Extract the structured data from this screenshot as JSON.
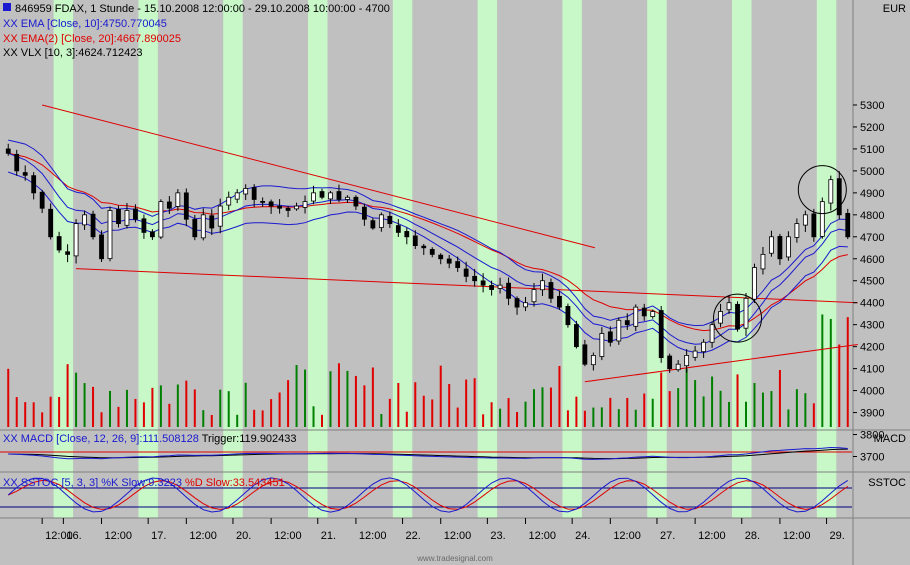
{
  "header": {
    "symbol_icon": "square-bullet-icon",
    "title": "846959  FDAX, 1 Stunde - 15.10.2008 12:00:00 - 29.10.2008 10:00:00 - 4700",
    "currency": "EUR"
  },
  "legend": [
    {
      "text": "XX EMA [Close, 10]:4750.770045",
      "color": "#1a1ad0"
    },
    {
      "text": "XX EMA(2) [Close, 20]:4667.890025",
      "color": "#e00000"
    },
    {
      "text": "XX VLX [10, 3]:4624.712423",
      "color": "#000000"
    }
  ],
  "macd_legend": {
    "prefix": "XX MACD [Close, 12, 26, 9]:111.508128",
    "trigger": " Trigger:119.902433",
    "tag": "MACD"
  },
  "sstoc_legend": {
    "prefix": "XX SSTOC [5, 3, 3] %K Slow:9.3223",
    "d": " %D Slow:33.543451",
    "tag": "SSTOC"
  },
  "watermark": "www.tradesignal.com",
  "colors": {
    "background": "#c0c0c0",
    "session_band": "#c8f7c8",
    "candle_up": "#ffffff",
    "candle_down": "#000000",
    "ema10": "#1a1ad0",
    "ema20": "#e00000",
    "vlx": "#000000",
    "volume_up": "#008000",
    "volume_down": "#e00000",
    "trendline": "#e00000"
  },
  "chart_data": {
    "type": "candlestick",
    "y_axis": {
      "label": "EUR",
      "ticks": [
        3700,
        3800,
        3900,
        4000,
        4100,
        4200,
        4300,
        4400,
        4500,
        4600,
        4700,
        4800,
        4900,
        5000,
        5100,
        5200,
        5300
      ],
      "range": [
        3620,
        5380
      ]
    },
    "x_ticks": [
      "12:00",
      "16.",
      "12:00",
      "17.",
      "12:00",
      "20.",
      "12:00",
      "21.",
      "12:00",
      "22.",
      "12:00",
      "23.",
      "12:00",
      "24.",
      "12:00",
      "27.",
      "12:00",
      "28.",
      "12:00",
      "29."
    ],
    "sessions": [
      "15.10.2008",
      "16.10.2008",
      "17.10.2008",
      "20.10.2008",
      "21.10.2008",
      "22.10.2008",
      "23.10.2008",
      "24.10.2008",
      "27.10.2008",
      "28.10.2008",
      "29.10.2008"
    ],
    "session_close_path": [
      [
        5080,
        5000,
        4980,
        4900,
        4830,
        4700,
        4640
      ],
      [
        4620,
        4760,
        4800,
        4700,
        4600,
        4820,
        4760,
        4820,
        4780,
        4720
      ],
      [
        4700,
        4860,
        4830,
        4900,
        4780,
        4700,
        4800,
        4740,
        4840,
        4880
      ],
      [
        4900,
        4920,
        4870,
        4860,
        4840,
        4830,
        4820,
        4840,
        4860,
        4900
      ],
      [
        4880,
        4900,
        4870,
        4880,
        4840,
        4780,
        4740,
        4800,
        4760,
        4720
      ],
      [
        4700,
        4660,
        4650,
        4620,
        4600,
        4580,
        4560,
        4520,
        4500,
        4480
      ],
      [
        4460,
        4480,
        4420,
        4380,
        4400,
        4460,
        4500,
        4420,
        4380,
        4300
      ],
      [
        4200,
        4120,
        4160,
        4260,
        4220,
        4320,
        4300,
        4380,
        4340,
        4360
      ],
      [
        4150,
        4100,
        4120,
        4160,
        4180,
        4220,
        4300,
        4360,
        4400,
        4280
      ],
      [
        4420,
        4560,
        4620,
        4700,
        4600,
        4700,
        4760,
        4800,
        4700,
        4860
      ],
      [
        4960,
        4800,
        4700
      ]
    ],
    "series": [
      {
        "name": "EMA [Close, 10]",
        "last": 4750.770045
      },
      {
        "name": "EMA(2) [Close, 20]",
        "last": 4667.890025
      },
      {
        "name": "VLX [10, 3]",
        "last": 4624.712423
      }
    ],
    "trendlines": [
      {
        "from": [
          "15.10.2008 12:00",
          5300
        ],
        "to": [
          "24.10.2008 09:00",
          4650
        ]
      },
      {
        "from": [
          "16.10.2008 09:00",
          4555
        ],
        "to": [
          "29.10.2008 12:00",
          4400
        ]
      },
      {
        "from": [
          "24.10.2008 09:00",
          4040
        ],
        "to": [
          "29.10.2008 12:00",
          4210
        ]
      }
    ],
    "annotations": [
      {
        "type": "circle",
        "at": [
          "27.10.2008 17:00",
          4330
        ]
      },
      {
        "type": "circle",
        "at": [
          "28.10.2008 17:00",
          4915
        ]
      }
    ],
    "macd": {
      "value": 111.508128,
      "trigger": 119.902433
    },
    "sstoc": {
      "k_slow": 9.3223,
      "d_slow": 33.543451
    }
  }
}
